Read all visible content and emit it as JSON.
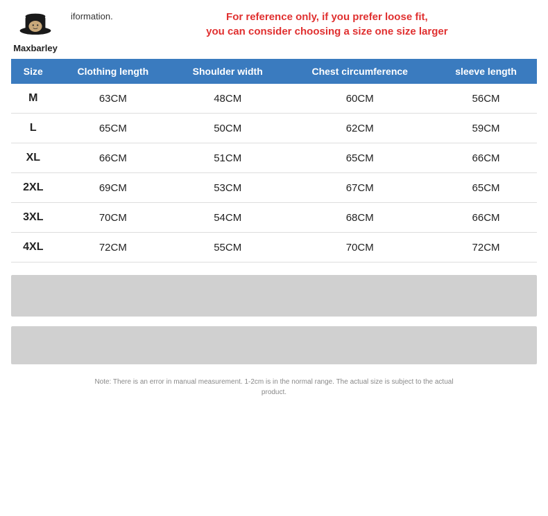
{
  "header": {
    "logo_text": "Maxbarley",
    "info_text": "iformation.",
    "notice_line1": "For reference only, if you prefer loose fit,",
    "notice_line2": "you can consider choosing a size one size larger"
  },
  "table": {
    "columns": [
      "Size",
      "Clothing length",
      "Shoulder width",
      "Chest circumference",
      "sleeve length"
    ],
    "rows": [
      [
        "M",
        "63CM",
        "48CM",
        "60CM",
        "56CM"
      ],
      [
        "L",
        "65CM",
        "50CM",
        "62CM",
        "59CM"
      ],
      [
        "XL",
        "66CM",
        "51CM",
        "65CM",
        "66CM"
      ],
      [
        "2XL",
        "69CM",
        "53CM",
        "67CM",
        "65CM"
      ],
      [
        "3XL",
        "70CM",
        "54CM",
        "68CM",
        "66CM"
      ],
      [
        "4XL",
        "72CM",
        "55CM",
        "70CM",
        "72CM"
      ]
    ]
  },
  "note": {
    "text": "Note: There is an error in manual measurement. 1-2cm is in the normal range. The actual size is subject to the actual product."
  }
}
